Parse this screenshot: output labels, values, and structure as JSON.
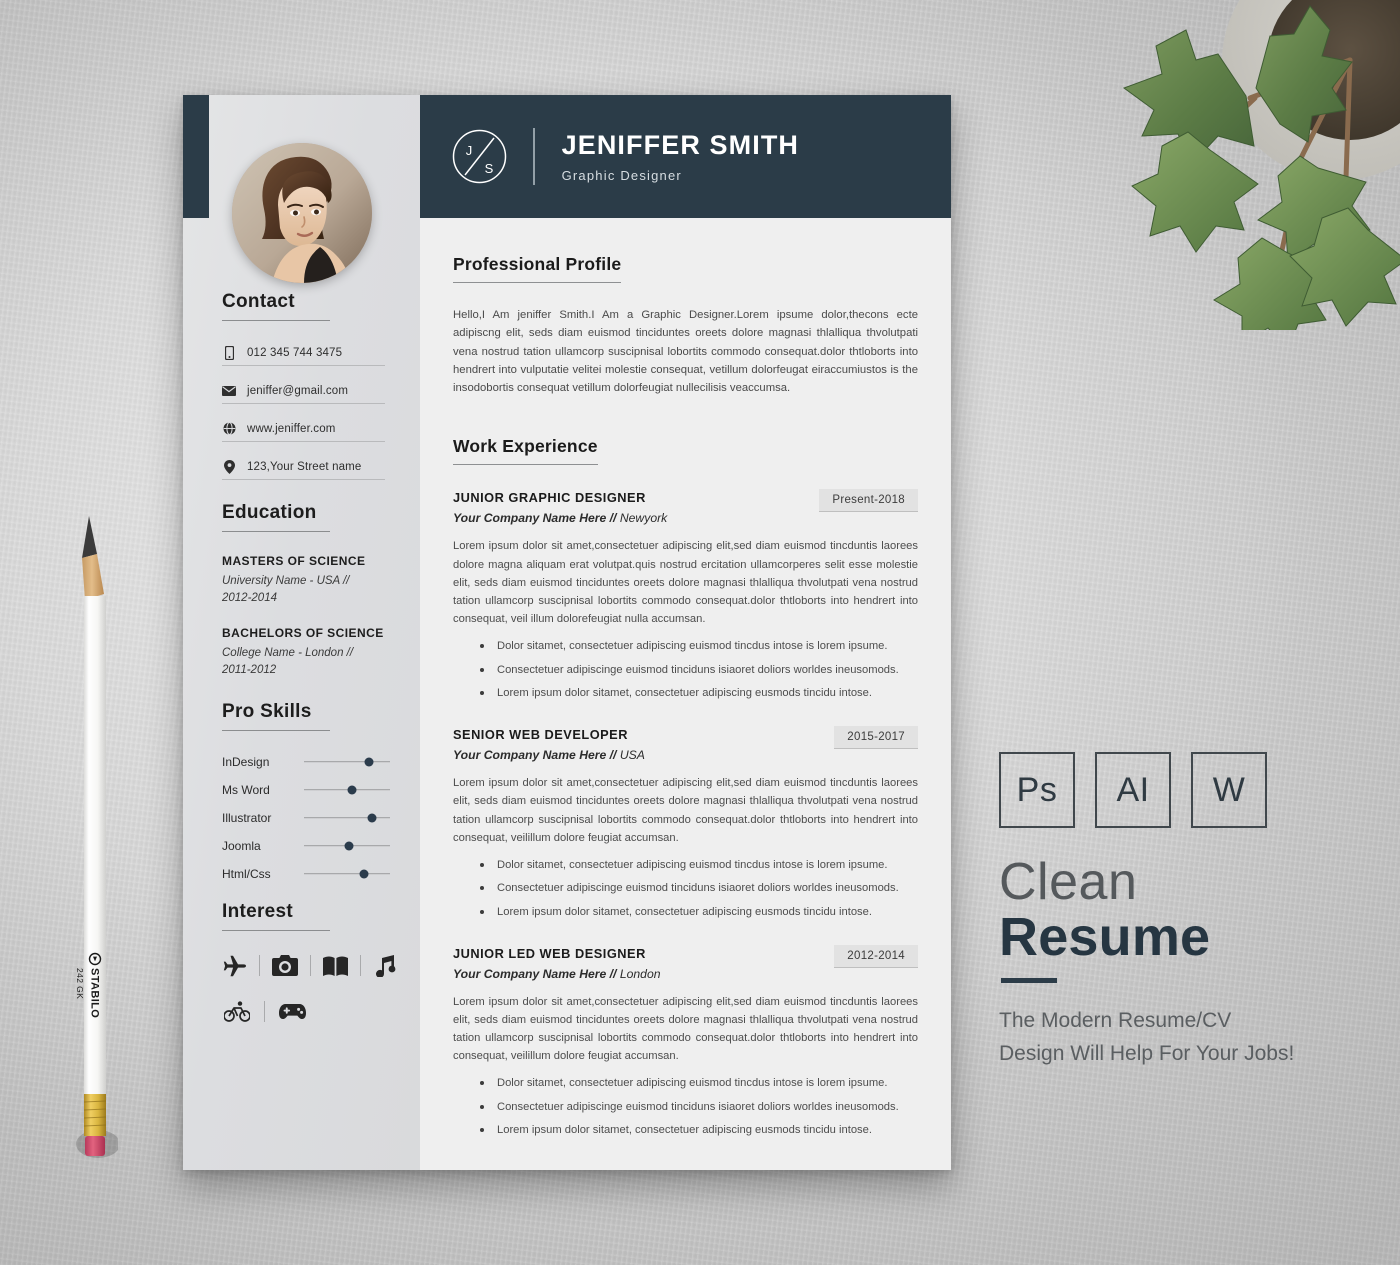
{
  "resume": {
    "header": {
      "monogram_initials": [
        "J",
        "S"
      ],
      "name": "JENIFFER SMITH",
      "role": "Graphic Designer"
    },
    "sidebar": {
      "contact": {
        "title": "Contact",
        "items": [
          {
            "icon": "phone-icon",
            "value": "012 345 744 3475"
          },
          {
            "icon": "envelope-icon",
            "value": "jeniffer@gmail.com"
          },
          {
            "icon": "globe-icon",
            "value": "www.jeniffer.com"
          },
          {
            "icon": "location-pin-icon",
            "value": "123,Your Street name"
          }
        ]
      },
      "education": {
        "title": "Education",
        "items": [
          {
            "degree": "MASTERS OF SCIENCE",
            "meta": "University Name - USA // 2012-2014"
          },
          {
            "degree": "BACHELORS OF SCIENCE",
            "meta": "College Name - London // 2011-2012"
          }
        ]
      },
      "skills": {
        "title": "Pro Skills",
        "items": [
          {
            "name": "InDesign",
            "level": 76
          },
          {
            "name": "Ms Word",
            "level": 56
          },
          {
            "name": "Illustrator",
            "level": 79
          },
          {
            "name": "Joomla",
            "level": 52
          },
          {
            "name": "Html/Css",
            "level": 70
          }
        ]
      },
      "interest": {
        "title": "Interest",
        "icons": [
          "airplane-icon",
          "camera-icon",
          "book-icon",
          "music-note-icon",
          "bicycle-icon",
          "gamepad-icon"
        ]
      }
    },
    "main": {
      "profile": {
        "title": "Professional Profile",
        "text": "Hello,I Am jeniffer Smith.I Am a Graphic Designer.Lorem ipsume dolor,thecons ecte adipiscng elit, seds diam euismod tinciduntes oreets dolore magnasi thlalliqua thvolutpati vena nostrud tation ullamcorp suscipnisal lobortits  commodo consequat.dolor thtloborts into hendrert into vulputatie velitei molestie consequat, vetillum dolorfeugat eiraccumiustos is the insodobortis consequat vetillum dolorfeugiat nullecilisis veaccumsa."
      },
      "work": {
        "title": "Work Experience",
        "jobs": [
          {
            "title": "JUNIOR GRAPHIC DESIGNER",
            "company": "Your Company Name Here //",
            "location": "Newyork",
            "date": "Present-2018",
            "description": "Lorem ipsum dolor sit amet,consectetuer adipiscing elit,sed diam euismod tincduntis laorees dolore magna aliquam erat volutpat.quis nostrud ercitation ullamcorperes selit esse molestie elit, seds diam euismod tinciduntes oreets dolore magnasi thlalliqua thvolutpati vena nostrud tation ullamcorp suscipnisal lobortits  commodo consequat.dolor thtloborts into hendrert into  consequat, veil illum dolorefeugiat nulla accumsan.",
            "bullets": [
              "Dolor sitamet, consectetuer adipiscing euismod tincdus intose is lorem ipsume.",
              "Consectetuer adipiscinge euismod tinciduns  isiaoret doliors worldes ineusomods.",
              "Lorem ipsum dolor sitamet, consectetuer adipiscing eusmods tincidu intose."
            ]
          },
          {
            "title": "SENIOR WEB DEVELOPER",
            "company": "Your Company Name Here //",
            "location": "USA",
            "date": "2015-2017",
            "description": "Lorem ipsum dolor sit amet,consectetuer adipiscing elit,sed diam euismod tincduntis laorees elit, seds diam euismod tinciduntes oreets dolore magnasi thlalliqua thvolutpati vena nostrud tation ullamcorp suscipnisal lobortits  commodo consequat.dolor thtloborts into hendrert into  consequat, veilillum dolore feugiat accumsan.",
            "bullets": [
              "Dolor sitamet, consectetuer adipiscing euismod tincdus intose is lorem ipsume.",
              "Consectetuer adipiscinge euismod tinciduns  isiaoret doliors worldes ineusomods.",
              "Lorem ipsum dolor sitamet, consectetuer adipiscing eusmods tincidu intose."
            ]
          },
          {
            "title": "JUNIOR LED WEB DESIGNER",
            "company": "Your Company Name Here //",
            "location": "London",
            "date": "2012-2014",
            "description": "Lorem ipsum dolor sit amet,consectetuer adipiscing elit,sed diam euismod tincduntis laorees elit, seds diam euismod tinciduntes oreets dolore magnasi thlalliqua thvolutpati vena nostrud tation ullamcorp suscipnisal lobortits  commodo consequat.dolor thtloborts into hendrert into  consequat, veilillum dolore feugiat accumsan.",
            "bullets": [
              "Dolor sitamet, consectetuer adipiscing euismod tincdus intose is lorem ipsume.",
              "Consectetuer adipiscinge euismod tinciduns  isiaoret doliors worldes ineusomods.",
              "Lorem ipsum dolor sitamet, consectetuer adipiscing eusmods tincidu intose."
            ]
          }
        ]
      }
    }
  },
  "promo": {
    "badges": [
      "Ps",
      "AI",
      "W"
    ],
    "title_light": "Clean",
    "title_bold": "Resume",
    "tagline_line1": "The Modern Resume/CV",
    "tagline_line2": "Design Will Help For Your Jobs!"
  },
  "props": {
    "pencil_brand": "STABILO",
    "pencil_model": "242 GK"
  },
  "colors": {
    "navy": "#2b3c48",
    "sidebar": "#dcdde0",
    "page": "#efefef",
    "badge": "#e2e2e2",
    "accent_text": "#263642"
  }
}
